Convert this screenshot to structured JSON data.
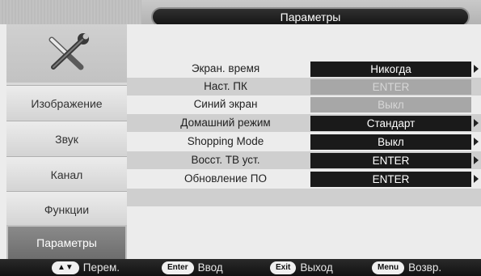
{
  "header": {
    "title": "Параметры"
  },
  "sidebar": {
    "items": [
      {
        "label": "Изображение"
      },
      {
        "label": "Звук"
      },
      {
        "label": "Канал"
      },
      {
        "label": "Функции"
      },
      {
        "label": "Параметры",
        "active": true
      }
    ]
  },
  "settings": {
    "rows": [
      {
        "label": "Экран. время",
        "value": "Никогда",
        "disabled": false,
        "arrow": true
      },
      {
        "label": "Наст. ПК",
        "value": "ENTER",
        "disabled": true,
        "arrow": false
      },
      {
        "label": "Синий экран",
        "value": "Выкл",
        "disabled": true,
        "arrow": false
      },
      {
        "label": "Домашний режим",
        "value": "Стандарт",
        "disabled": false,
        "arrow": true
      },
      {
        "label": "Shopping Mode",
        "value": "Выкл",
        "disabled": false,
        "arrow": true
      },
      {
        "label": "Восст. ТВ уст.",
        "value": "ENTER",
        "disabled": false,
        "arrow": true
      },
      {
        "label": "Обновление ПО",
        "value": "ENTER",
        "disabled": false,
        "arrow": true
      }
    ]
  },
  "footer": {
    "hints": [
      {
        "key": "▲▼",
        "label": "Перем."
      },
      {
        "key": "Enter",
        "label": "Ввод"
      },
      {
        "key": "Exit",
        "label": "Выход"
      },
      {
        "key": "Menu",
        "label": "Возвр."
      }
    ]
  },
  "colors": {
    "value_box": "#1a1a1a",
    "value_box_disabled": "#a7a7a7",
    "active_sidebar": "#7a7a7a",
    "bottom_bar": "#1a1a1a"
  },
  "icons": {
    "settings_tile": "wrench-screwdriver-icon"
  }
}
